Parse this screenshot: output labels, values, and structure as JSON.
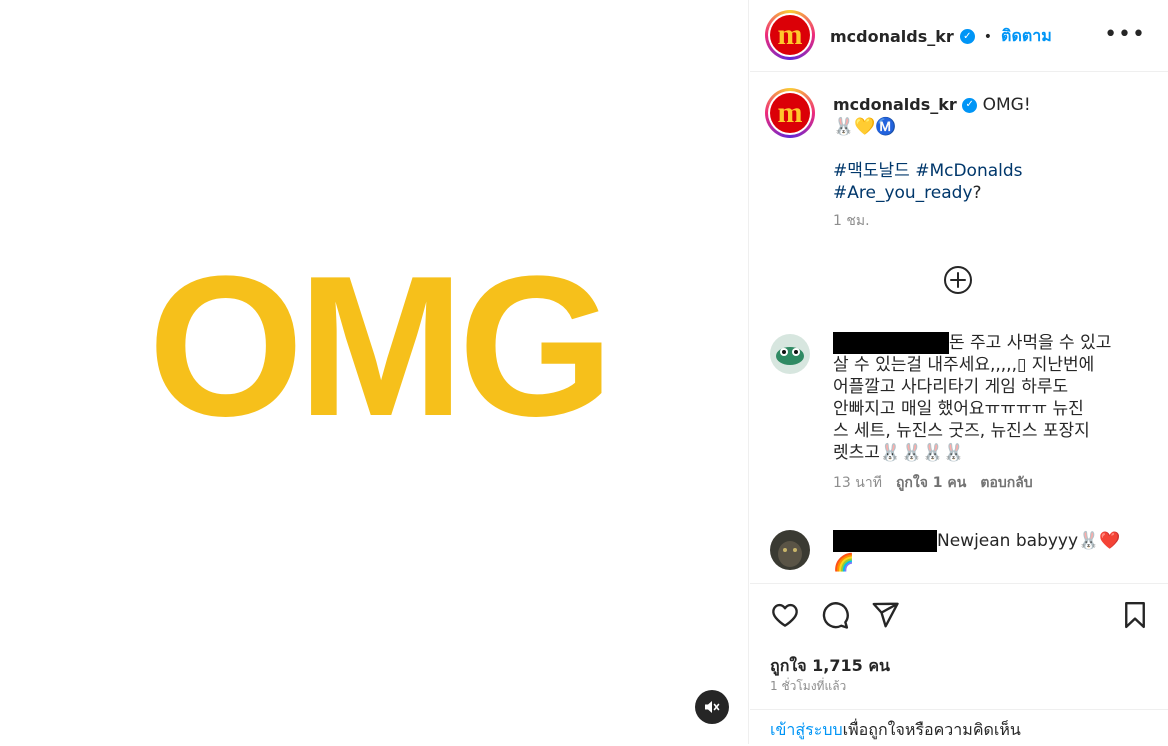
{
  "post": {
    "media_text": "OMG",
    "mute_icon": "speaker-muted-icon"
  },
  "header": {
    "username": "mcdonalds_kr",
    "dot": "•",
    "follow_label": "ติดตาม",
    "more_icon": "more-options-icon",
    "dots": "•••"
  },
  "caption": {
    "username": "mcdonalds_kr",
    "text": "OMG!",
    "emoji_line": "🐰💛Ⓜ️",
    "hashtags_line1": "#맥도날드 #McDonalds",
    "hashtag3": "#Are_you_ready",
    "hashtag3_suffix": "?",
    "time": "1 ชม."
  },
  "load_more_icon": "plus-circle-icon",
  "comments": [
    {
      "username_redacted": true,
      "text": "돈 주고 사먹을 수 있고 살 수 있는걸 내주세요,,,,,🥺 지난번에 어플깔고 사다리타기 게임 하루도 안빠지고 매일 했어요ㅠㅠㅠㅠ 뉴진스 세트, 뉴진스 굿즈, 뉴진스 포장지 렛츠고🐰🐰🐰🐰",
      "line1": "돈 주고 사먹을 수 있고",
      "line2": "살 수 있는걸 내주세요,,,,,▯ 지난번에",
      "line3": "어플깔고 사다리타기 게임 하루도",
      "line4": "안빠지고 매일 했어요ㅠㅠㅠㅠ 뉴진",
      "line5": "스 세트, 뉴진스 굿즈, 뉴진스 포장지",
      "line6": "렛츠고🐰🐰🐰🐰",
      "time": "13 นาที",
      "likes": "ถูกใจ 1 คน",
      "reply": "ตอบกลับ"
    },
    {
      "username_redacted": true,
      "text_line1": "Newjean babyyy🐰❤️",
      "text_line2": "🌈"
    }
  ],
  "actions": {
    "like_icon": "heart-icon",
    "comment_icon": "comment-icon",
    "share_icon": "send-icon",
    "save_icon": "bookmark-icon",
    "likes": "ถูกใจ 1,715 คน",
    "time": "1 ชั่วโมงที่แล้ว"
  },
  "login": {
    "link": "เข้าสู่ระบบ",
    "text": "เพื่อถูกใจหรือความคิดเห็น"
  }
}
